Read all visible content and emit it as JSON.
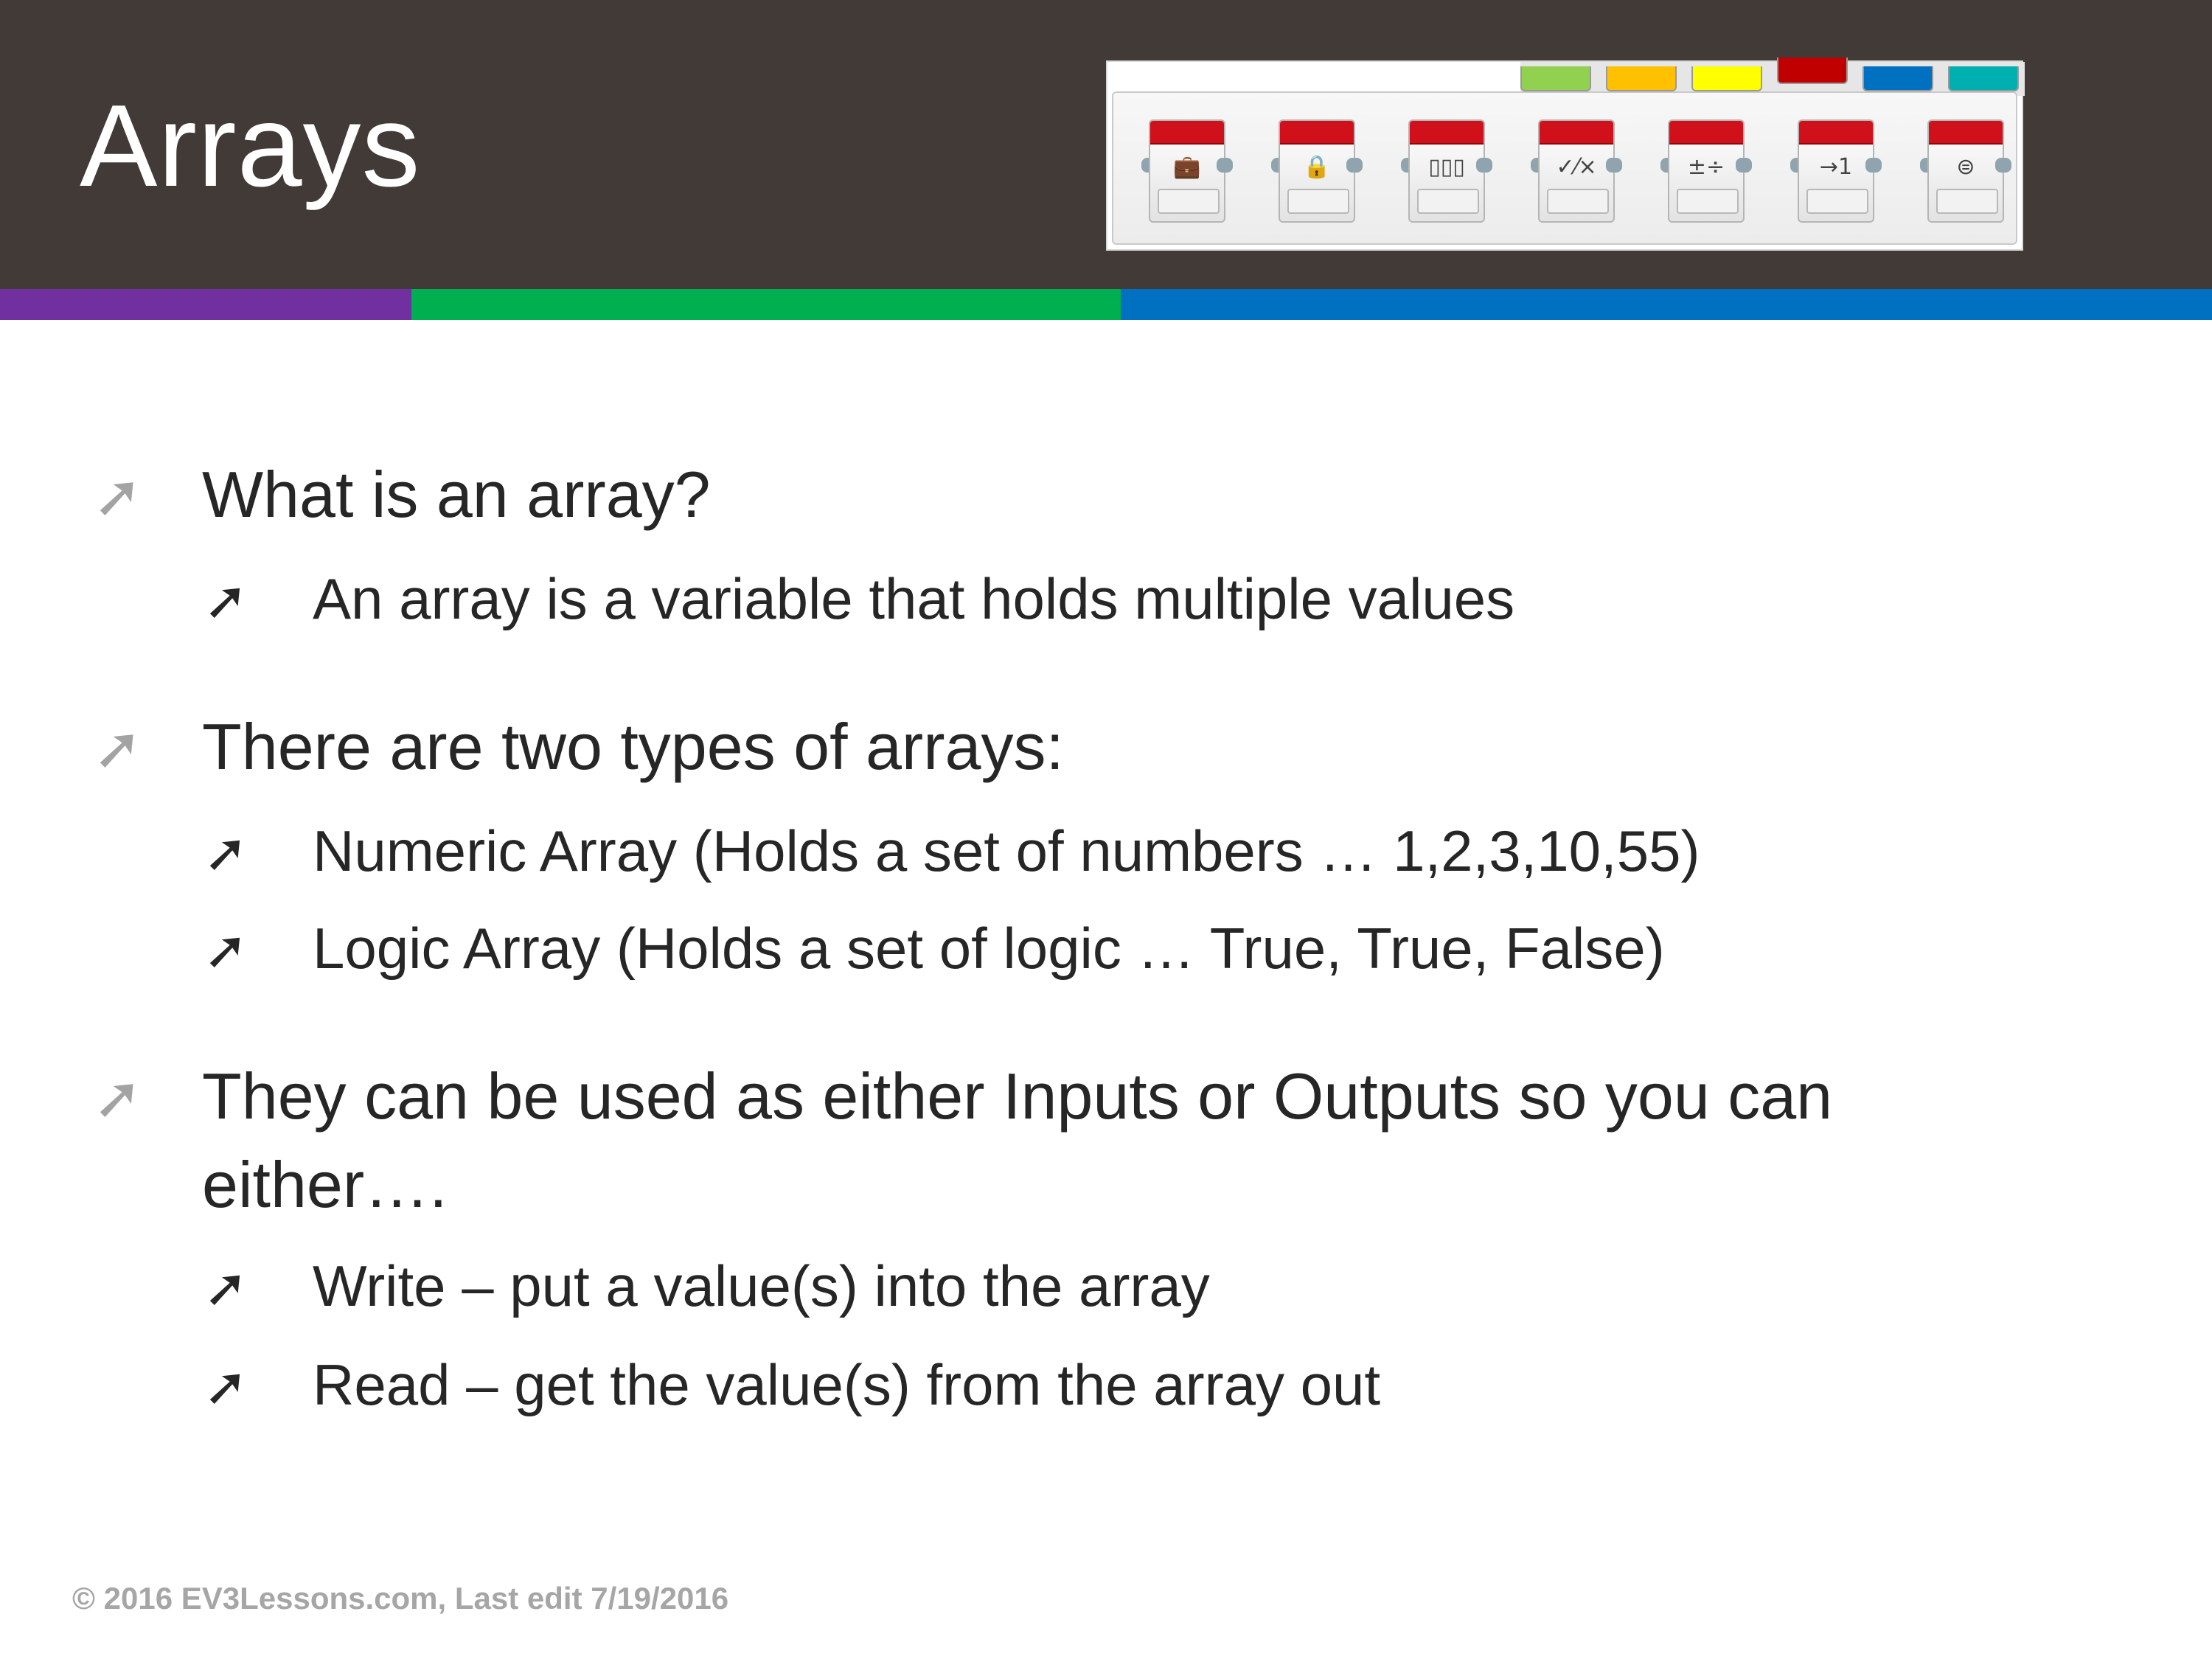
{
  "slide": {
    "title": "Arrays",
    "stripe_colors": [
      "#7030a0",
      "#00b050",
      "#0070c0"
    ],
    "header_color": "#413a37"
  },
  "palette": {
    "tab_colors": [
      "#92d050",
      "#ffc000",
      "#ffff00",
      "#c00000",
      "#0070c0",
      "#00b0b0"
    ],
    "blocks": [
      {
        "name": "variable-block",
        "icon": "suitcase-icon",
        "glyph": "💼"
      },
      {
        "name": "constant-block",
        "icon": "locked-suitcase-icon",
        "glyph": "🔒"
      },
      {
        "name": "array-operations-block",
        "icon": "array-icon",
        "glyph": "▯▯▯"
      },
      {
        "name": "logic-operations-block",
        "icon": "logic-icon",
        "glyph": "✓⁄×"
      },
      {
        "name": "math-block",
        "icon": "math-icon",
        "glyph": "±÷"
      },
      {
        "name": "round-block",
        "icon": "round-icon",
        "glyph": "→1"
      },
      {
        "name": "compare-block",
        "icon": "compare-icon",
        "glyph": "⊜"
      }
    ]
  },
  "bullets": [
    {
      "level": 1,
      "text": "What is an array?"
    },
    {
      "level": 2,
      "text": "An array is a variable that holds multiple values"
    },
    {
      "level": 1,
      "text": "There are two types of arrays:"
    },
    {
      "level": 2,
      "text": "Numeric Array (Holds a set of numbers … 1,2,3,10,55)"
    },
    {
      "level": 2,
      "text": "Logic Array (Holds a set of logic … True, True, False)"
    },
    {
      "level": 1,
      "text": "They can be used as either Inputs or Outputs so you can"
    },
    {
      "level": 1,
      "text": "either…."
    },
    {
      "level": 2,
      "text": "Write – put a value(s) into the array"
    },
    {
      "level": 2,
      "text": "Read – get the value(s) from the array out"
    }
  ],
  "footer": {
    "text": "© 2016 EV3Lessons.com, Last edit 7/19/2016"
  }
}
